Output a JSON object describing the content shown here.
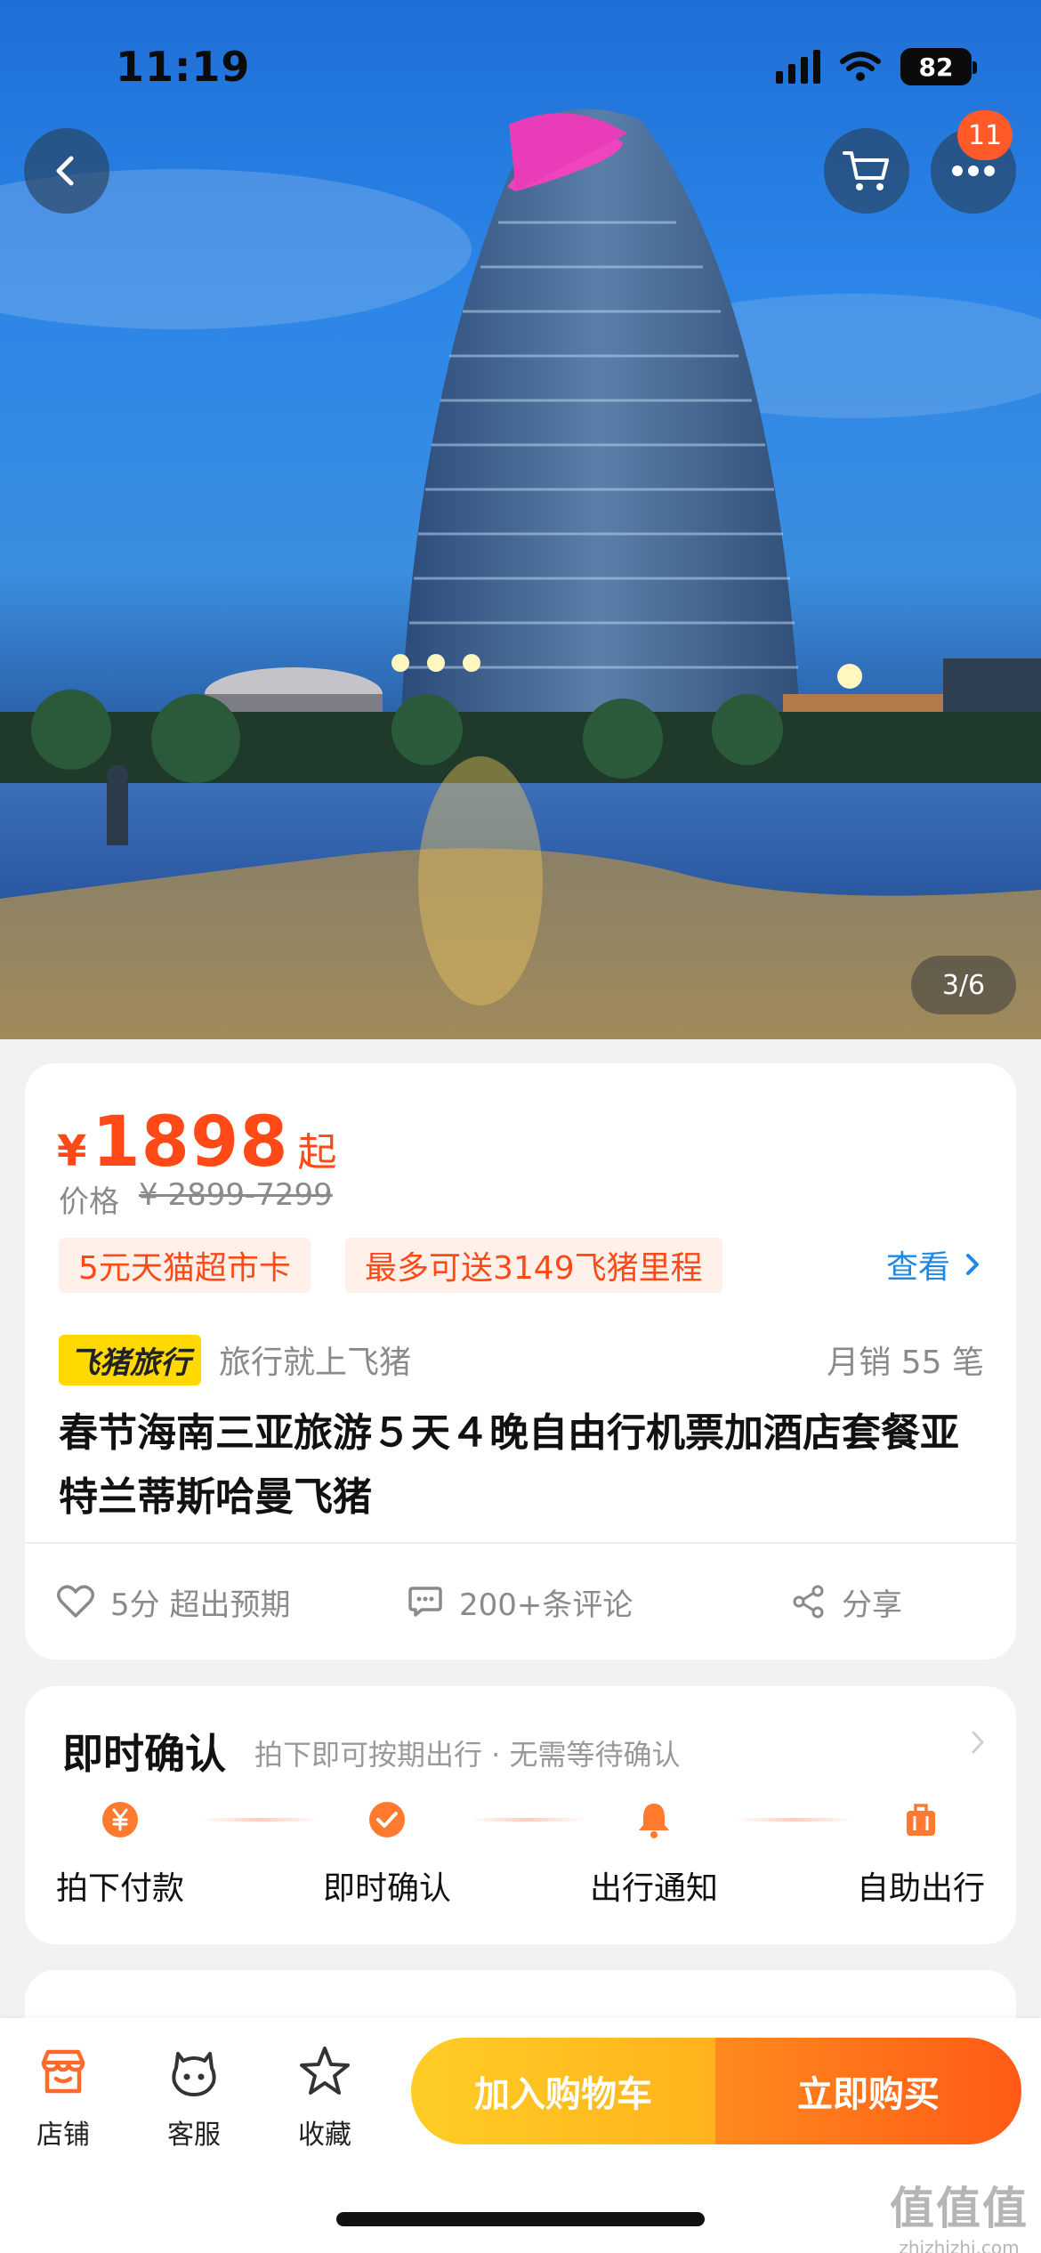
{
  "status_bar": {
    "time": "11:19",
    "battery": "82"
  },
  "nav": {
    "cart_badge_count": "11",
    "image_indicator": "3/6"
  },
  "product": {
    "currency": "¥",
    "price": "1898",
    "price_suffix": "起",
    "original_price_label": "价格",
    "original_price": "¥ 2899-7299",
    "promo_tags": [
      "5元天猫超市卡",
      "最多可送3149飞猪里程"
    ],
    "view_link": "查看",
    "brand_logo": "飞猪旅行",
    "brand_slogan": "旅行就上飞猪",
    "monthly_sales": "月销 55 笔",
    "title": "春节海南三亚旅游５天４晚自由行机票加酒店套餐亚特兰蒂斯哈曼飞猪"
  },
  "actions": {
    "rating": "5分 超出预期",
    "reviews": "200+条评论",
    "share": "分享"
  },
  "instant_confirm": {
    "title": "即时确认",
    "subtitle": "拍下即可按期出行 · 无需等待确认",
    "steps": [
      "拍下付款",
      "即时确认",
      "出行通知",
      "自助出行"
    ]
  },
  "bottom_bar": {
    "shop": "店铺",
    "service": "客服",
    "favorite": "收藏",
    "add_to_cart": "加入购物车",
    "buy_now": "立即购买"
  },
  "watermark": {
    "mark": "值值值",
    "url": "zhizhizhi.com"
  },
  "colors": {
    "accent_orange": "#ff4a17",
    "link_blue": "#1e88e5",
    "brand_yellow": "#ffd900"
  }
}
